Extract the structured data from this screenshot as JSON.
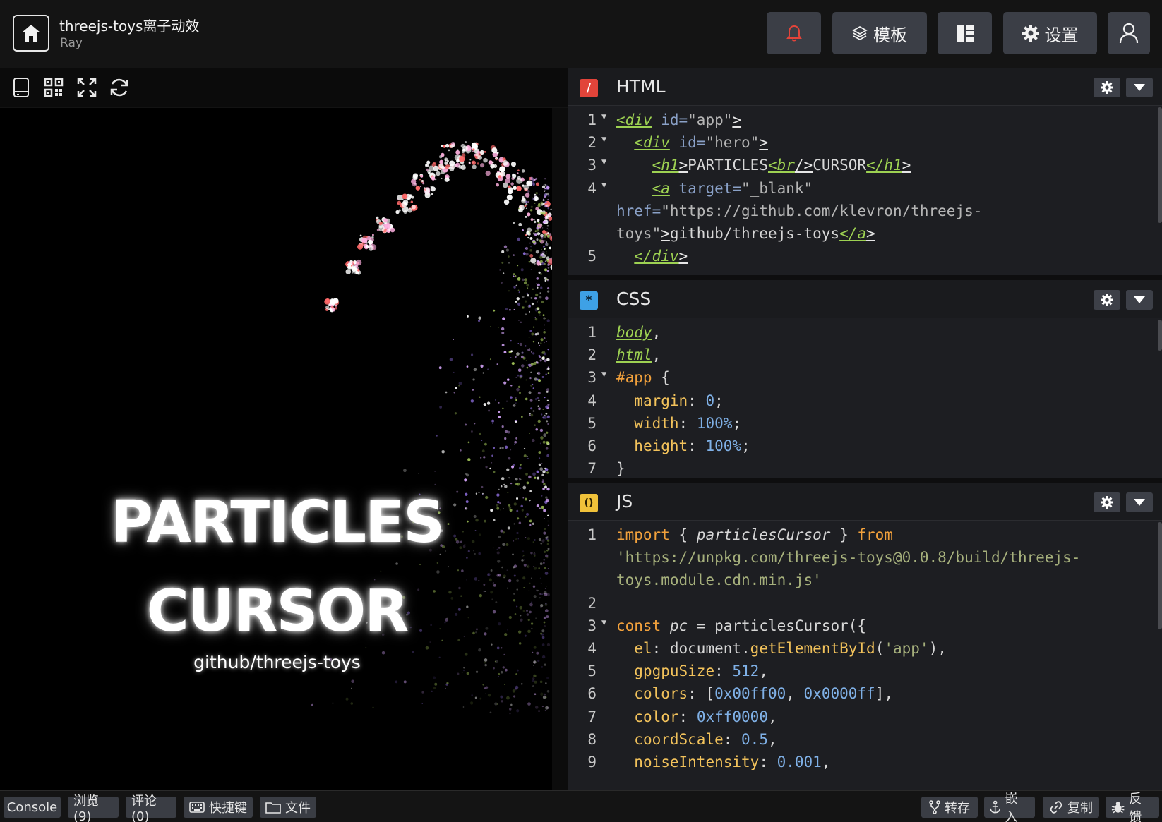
{
  "header": {
    "title": "threejs-toys离子动效",
    "author": "Ray",
    "template_label": "模板",
    "settings_label": "设置"
  },
  "preview": {
    "hero_title_line1": "PARTICLES",
    "hero_title_line2": "CURSOR",
    "hero_link": "github/threejs-toys"
  },
  "panels": {
    "html": {
      "name": "HTML",
      "icon_glyph": "/",
      "icon_color": "#e2443a"
    },
    "css": {
      "name": "CSS",
      "icon_glyph": "*",
      "icon_color": "#3ea1e6"
    },
    "js": {
      "name": "JS",
      "icon_glyph": "()",
      "icon_color": "#f0c23a"
    }
  },
  "code": {
    "html": [
      {
        "n": "1",
        "fold": true,
        "parts": [
          [
            "tag",
            "<div"
          ],
          [
            "attr",
            " id="
          ],
          [
            "str",
            "\"app\""
          ],
          [
            "br",
            ">"
          ]
        ]
      },
      {
        "n": "2",
        "fold": true,
        "parts": [
          [
            "plain",
            "  "
          ],
          [
            "tag",
            "<div"
          ],
          [
            "attr",
            " id="
          ],
          [
            "str",
            "\"hero\""
          ],
          [
            "br",
            ">"
          ]
        ]
      },
      {
        "n": "3",
        "fold": true,
        "parts": [
          [
            "plain",
            "    "
          ],
          [
            "tag",
            "<h1"
          ],
          [
            "br",
            ">"
          ],
          [
            "plain",
            "PARTICLES"
          ],
          [
            "tag",
            "<br"
          ],
          [
            "br",
            "/>"
          ],
          [
            "plain",
            "CURSOR"
          ],
          [
            "tag",
            "</h1"
          ],
          [
            "br",
            ">"
          ]
        ]
      },
      {
        "n": "4",
        "fold": true,
        "parts": [
          [
            "plain",
            "    "
          ],
          [
            "tag",
            "<a"
          ],
          [
            "attr",
            " target="
          ],
          [
            "str",
            "\"_blank\""
          ]
        ]
      },
      {
        "n": "",
        "fold": false,
        "parts": [
          [
            "attr",
            "href="
          ],
          [
            "str",
            "\"https://github.com/klevron/threejs-"
          ]
        ]
      },
      {
        "n": "",
        "fold": false,
        "parts": [
          [
            "str",
            "toys\""
          ],
          [
            "br",
            ">"
          ],
          [
            "plain",
            "github/threejs-toys"
          ],
          [
            "tag",
            "</a"
          ],
          [
            "br",
            ">"
          ]
        ]
      },
      {
        "n": "5",
        "fold": false,
        "parts": [
          [
            "plain",
            "  "
          ],
          [
            "tag",
            "</div"
          ],
          [
            "br",
            ">"
          ]
        ]
      }
    ],
    "css": [
      {
        "n": "1",
        "fold": false,
        "parts": [
          [
            "sel",
            "body"
          ],
          [
            "plain",
            ","
          ]
        ]
      },
      {
        "n": "2",
        "fold": false,
        "parts": [
          [
            "sel",
            "html"
          ],
          [
            "plain",
            ","
          ]
        ]
      },
      {
        "n": "3",
        "fold": true,
        "parts": [
          [
            "idp",
            "#app"
          ],
          [
            "plain",
            " {"
          ]
        ]
      },
      {
        "n": "4",
        "fold": false,
        "parts": [
          [
            "plain",
            "  "
          ],
          [
            "prop",
            "margin"
          ],
          [
            "plain",
            ": "
          ],
          [
            "num",
            "0"
          ],
          [
            "plain",
            ";"
          ]
        ]
      },
      {
        "n": "5",
        "fold": false,
        "parts": [
          [
            "plain",
            "  "
          ],
          [
            "prop",
            "width"
          ],
          [
            "plain",
            ": "
          ],
          [
            "num",
            "100%"
          ],
          [
            "plain",
            ";"
          ]
        ]
      },
      {
        "n": "6",
        "fold": false,
        "parts": [
          [
            "plain",
            "  "
          ],
          [
            "prop",
            "height"
          ],
          [
            "plain",
            ": "
          ],
          [
            "num",
            "100%"
          ],
          [
            "plain",
            ";"
          ]
        ]
      },
      {
        "n": "7",
        "fold": false,
        "parts": [
          [
            "plain",
            "}"
          ]
        ]
      }
    ],
    "js": [
      {
        "n": "1",
        "fold": false,
        "parts": [
          [
            "kw",
            "import"
          ],
          [
            "plain",
            " { "
          ],
          [
            "var",
            "particlesCursor"
          ],
          [
            "plain",
            " } "
          ],
          [
            "kw",
            "from"
          ]
        ]
      },
      {
        "n": "",
        "fold": false,
        "parts": [
          [
            "strg",
            "'https://unpkg.com/threejs-toys@0.0.8/build/threejs-"
          ]
        ]
      },
      {
        "n": "",
        "fold": false,
        "parts": [
          [
            "strg",
            "toys.module.cdn.min.js'"
          ]
        ]
      },
      {
        "n": "2",
        "fold": false,
        "parts": [
          [
            "plain",
            ""
          ]
        ]
      },
      {
        "n": "3",
        "fold": true,
        "parts": [
          [
            "kw",
            "const"
          ],
          [
            "plain",
            " "
          ],
          [
            "var",
            "pc"
          ],
          [
            "plain",
            " = particlesCursor({"
          ]
        ]
      },
      {
        "n": "4",
        "fold": false,
        "parts": [
          [
            "plain",
            "  "
          ],
          [
            "prop",
            "el"
          ],
          [
            "plain",
            ": document."
          ],
          [
            "fn",
            "getElementById"
          ],
          [
            "plain",
            "("
          ],
          [
            "strg",
            "'app'"
          ],
          [
            "plain",
            "),"
          ]
        ]
      },
      {
        "n": "5",
        "fold": false,
        "parts": [
          [
            "plain",
            "  "
          ],
          [
            "prop",
            "gpgpuSize"
          ],
          [
            "plain",
            ": "
          ],
          [
            "num",
            "512"
          ],
          [
            "plain",
            ","
          ]
        ]
      },
      {
        "n": "6",
        "fold": false,
        "parts": [
          [
            "plain",
            "  "
          ],
          [
            "prop",
            "colors"
          ],
          [
            "plain",
            ": ["
          ],
          [
            "num",
            "0x00ff00"
          ],
          [
            "plain",
            ", "
          ],
          [
            "num",
            "0x0000ff"
          ],
          [
            "plain",
            "],"
          ]
        ]
      },
      {
        "n": "7",
        "fold": false,
        "parts": [
          [
            "plain",
            "  "
          ],
          [
            "prop",
            "color"
          ],
          [
            "plain",
            ": "
          ],
          [
            "num",
            "0xff0000"
          ],
          [
            "plain",
            ","
          ]
        ]
      },
      {
        "n": "8",
        "fold": false,
        "parts": [
          [
            "plain",
            "  "
          ],
          [
            "prop",
            "coordScale"
          ],
          [
            "plain",
            ": "
          ],
          [
            "num",
            "0.5"
          ],
          [
            "plain",
            ","
          ]
        ]
      },
      {
        "n": "9",
        "fold": false,
        "parts": [
          [
            "plain",
            "  "
          ],
          [
            "prop",
            "noiseIntensity"
          ],
          [
            "plain",
            ": "
          ],
          [
            "num",
            "0.001"
          ],
          [
            "plain",
            ","
          ]
        ]
      }
    ]
  },
  "footer": {
    "console": "Console",
    "views": "浏览(9)",
    "comments": "评论(0)",
    "shortcuts": "快捷键",
    "files": "文件",
    "fork": "转存",
    "embed": "嵌入",
    "copy": "复制",
    "feedback": "反馈"
  }
}
